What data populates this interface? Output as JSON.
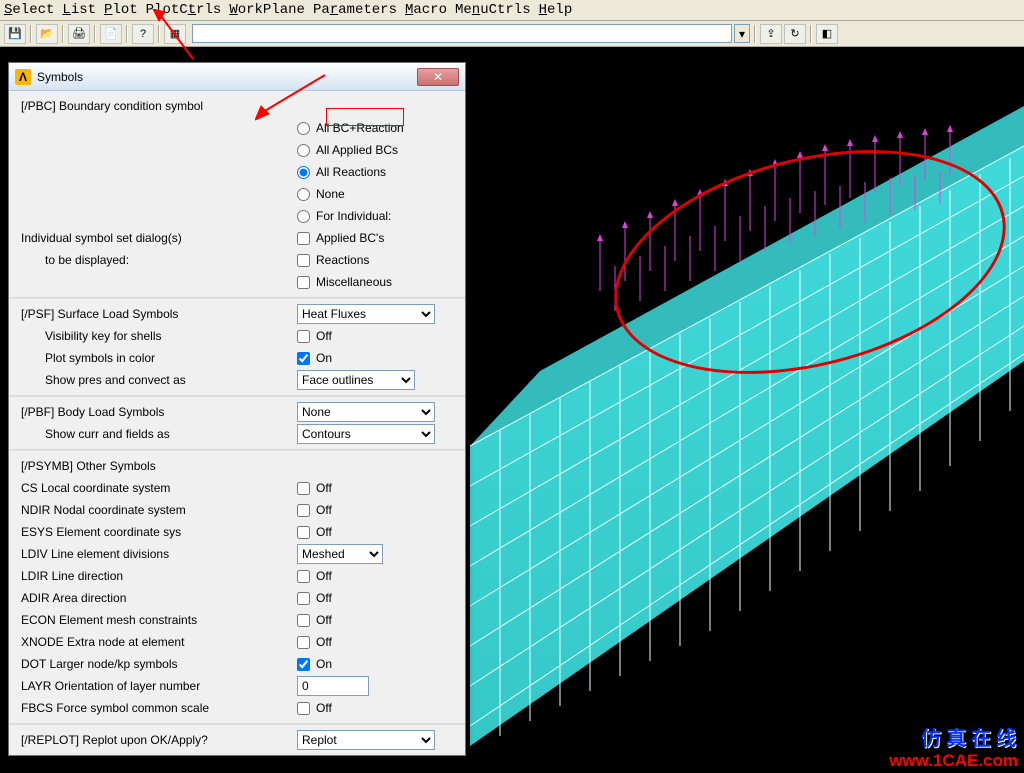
{
  "menus": {
    "select": "Select",
    "list": "List",
    "plot": "Plot",
    "plotctrls": "PlotCtrls",
    "workplane": "WorkPlane",
    "parameters": "Parameters",
    "macro": "Macro",
    "menuctrls": "MenuCtrls",
    "help": "Help"
  },
  "dialog": {
    "title": "Symbols",
    "titlebar_close": "✕",
    "pbc_heading": "[/PBC] Boundary condition symbol",
    "pbc_options": {
      "allbc": "All BC+Reaction",
      "applied": "All Applied BCs",
      "reactions": "All Reactions",
      "none": "None",
      "indiv": "For Individual:"
    },
    "indiv_label1": "Individual symbol set dialog(s)",
    "indiv_label2": "to be displayed:",
    "indiv_opts": {
      "appliedbc": "Applied BC's",
      "reactions": "Reactions",
      "misc": "Miscellaneous"
    },
    "psf_heading": "[/PSF]  Surface Load Symbols",
    "psf_select": "Heat Fluxes",
    "psf_vis_label": "Visibility key for shells",
    "psf_vis_val": "Off",
    "psf_color_label": "Plot symbols in color",
    "psf_color_val": "On",
    "psf_pres_label": "Show pres and convect as",
    "psf_pres_sel": "Face outlines",
    "pbf_heading": "[/PBF]  Body Load Symbols",
    "pbf_sel": "None",
    "pbf_show_label": "Show curr and fields as",
    "pbf_show_sel": "Contours",
    "psymb_heading": "[/PSYMB] Other Symbols",
    "rows": {
      "cs_label": "CS   Local coordinate system",
      "cs_val": "Off",
      "ndir_label": "NDIR Nodal coordinate system",
      "ndir_val": "Off",
      "esys_label": "ESYS Element coordinate sys",
      "esys_val": "Off",
      "ldiv_label": "LDIV  Line element divisions",
      "ldiv_sel": "Meshed",
      "ldir_label": "LDIR Line direction",
      "ldir_val": "Off",
      "adir_label": "ADIR Area direction",
      "adir_val": "Off",
      "econ_label": "ECON Element mesh constraints",
      "econ_val": "Off",
      "xnode_label": "XNODE Extra node at element",
      "xnode_val": "Off",
      "dot_label": "DOT  Larger node/kp symbols",
      "dot_val": "On",
      "layr_label": "LAYR Orientation of layer number",
      "layr_val": "0",
      "fbcs_label": "FBCS Force symbol common scale",
      "fbcs_val": "Off"
    },
    "replot_label": "[/REPLOT] Replot upon OK/Apply?",
    "replot_sel": "Replot"
  },
  "watermark": {
    "line1": "仿 真 在 线",
    "line2": "www.1CAE.com"
  }
}
